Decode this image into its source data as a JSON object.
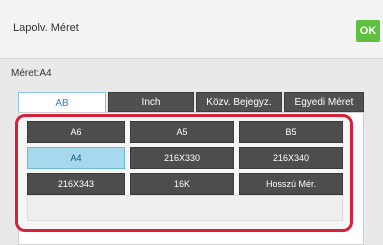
{
  "header": {
    "title": "Lapolv. Méret",
    "ok_label": "OK"
  },
  "size_label": "Méret:A4",
  "tabs": [
    {
      "label": "AB",
      "active": true
    },
    {
      "label": "Inch",
      "active": false
    },
    {
      "label": "Közv. Bejegyz.",
      "active": false
    },
    {
      "label": "Egyedi Méret",
      "active": false
    }
  ],
  "sizes": {
    "row1": [
      "A6",
      "A5",
      "B5"
    ],
    "row2": [
      "A4",
      "216X330",
      "216X340"
    ],
    "row3": [
      "216X343",
      "16K",
      "Hosszú Mér."
    ]
  },
  "selected_size": "A4",
  "colors": {
    "ok": "#5fbf3f",
    "highlight": "#d8203b",
    "selected": "#a6d9ee"
  }
}
